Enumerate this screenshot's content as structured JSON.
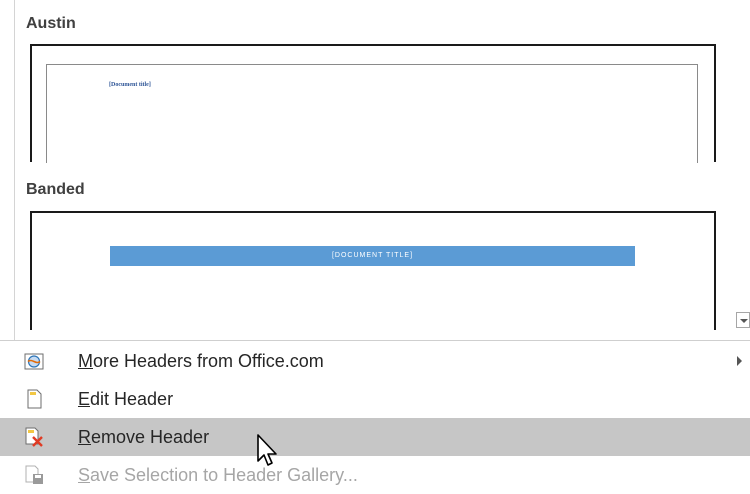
{
  "gallery": {
    "sections": [
      {
        "title": "Austin",
        "doc_title": "[Document title]"
      },
      {
        "title": "Banded",
        "doc_title": "[DOCUMENT TITLE]"
      }
    ]
  },
  "menu": {
    "items": [
      {
        "label_prefix": "",
        "mnemonic": "M",
        "label_rest": "ore Headers from Office.com",
        "icon": "globe-office-icon",
        "has_submenu": true,
        "disabled": false
      },
      {
        "label_prefix": "",
        "mnemonic": "E",
        "label_rest": "dit Header",
        "icon": "edit-header-page-icon",
        "disabled": false
      },
      {
        "label_prefix": "",
        "mnemonic": "R",
        "label_rest": "emove Header",
        "icon": "remove-header-icon",
        "disabled": false,
        "hovered": true
      },
      {
        "label_prefix": "",
        "mnemonic": "S",
        "label_rest": "ave Selection to Header Gallery...",
        "icon": "save-selection-icon",
        "disabled": true
      }
    ]
  },
  "colors": {
    "banded_bar": "#5b9bd5",
    "hover": "#c6c6c6",
    "disabled_text": "#a6a6a6"
  }
}
